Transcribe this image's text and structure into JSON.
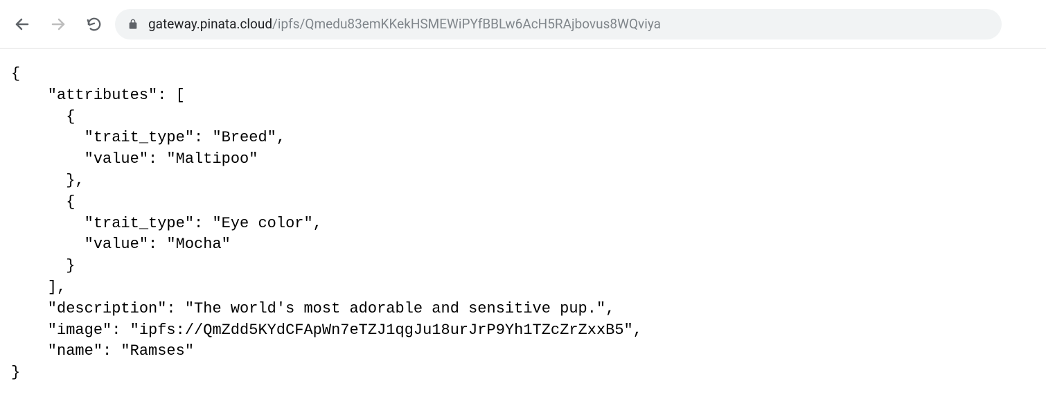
{
  "url": {
    "domain": "gateway.pinata.cloud",
    "path": "/ipfs/Qmedu83emKKekHSMEWiPYfBBLw6AcH5RAjbovus8WQviya"
  },
  "json_content": {
    "attributes": [
      {
        "trait_type": "Breed",
        "value": "Maltipoo"
      },
      {
        "trait_type": "Eye color",
        "value": "Mocha"
      }
    ],
    "description": "The world's most adorable and sensitive pup.",
    "image": "ipfs://QmZdd5KYdCFApWn7eTZJ1qgJu18urJrP9Yh1TZcZrZxxB5",
    "name": "Ramses"
  }
}
